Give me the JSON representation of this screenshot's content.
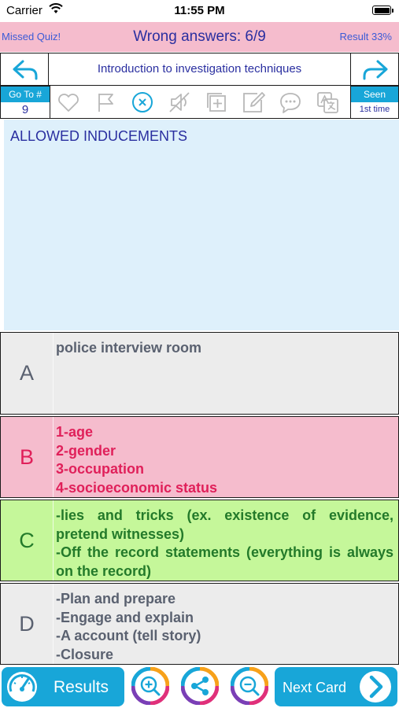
{
  "status": {
    "carrier": "Carrier",
    "time": "11:55 PM"
  },
  "header": {
    "missed": "Missed Quiz!",
    "wrong": "Wrong answers: 6/9",
    "result": "Result 33%"
  },
  "nav": {
    "title": "Introduction to investigation techniques"
  },
  "toolbar": {
    "goto_label": "Go To #",
    "goto_value": "9",
    "seen_label": "Seen",
    "seen_value": "1st time",
    "icons": [
      "heart-icon",
      "flag-icon",
      "close-circle-icon",
      "mute-icon",
      "add-icon",
      "edit-icon",
      "chat-icon",
      "translate-icon"
    ]
  },
  "question": {
    "text": "ALLOWED INDUCEMENTS"
  },
  "answers": [
    {
      "letter": "A",
      "text": "police interview room"
    },
    {
      "letter": "B",
      "text": "1-age\n2-gender\n3-occupation\n4-socioeconomic status"
    },
    {
      "letter": "C",
      "text": "-lies and tricks (ex. existence of evidence, pretend witnesses)\n-Off the record statements (everything is always on the record)"
    },
    {
      "letter": "D",
      "text": "-Plan and prepare\n-Engage and explain\n-A account (tell story)\n-Closure"
    }
  ],
  "footer": {
    "results": "Results",
    "next": "Next Card"
  },
  "colors": {
    "accent": "#18a6d8",
    "header_pink": "#f5bccd",
    "question_bg": "#def0fb",
    "correct_green": "#c5f79a"
  }
}
